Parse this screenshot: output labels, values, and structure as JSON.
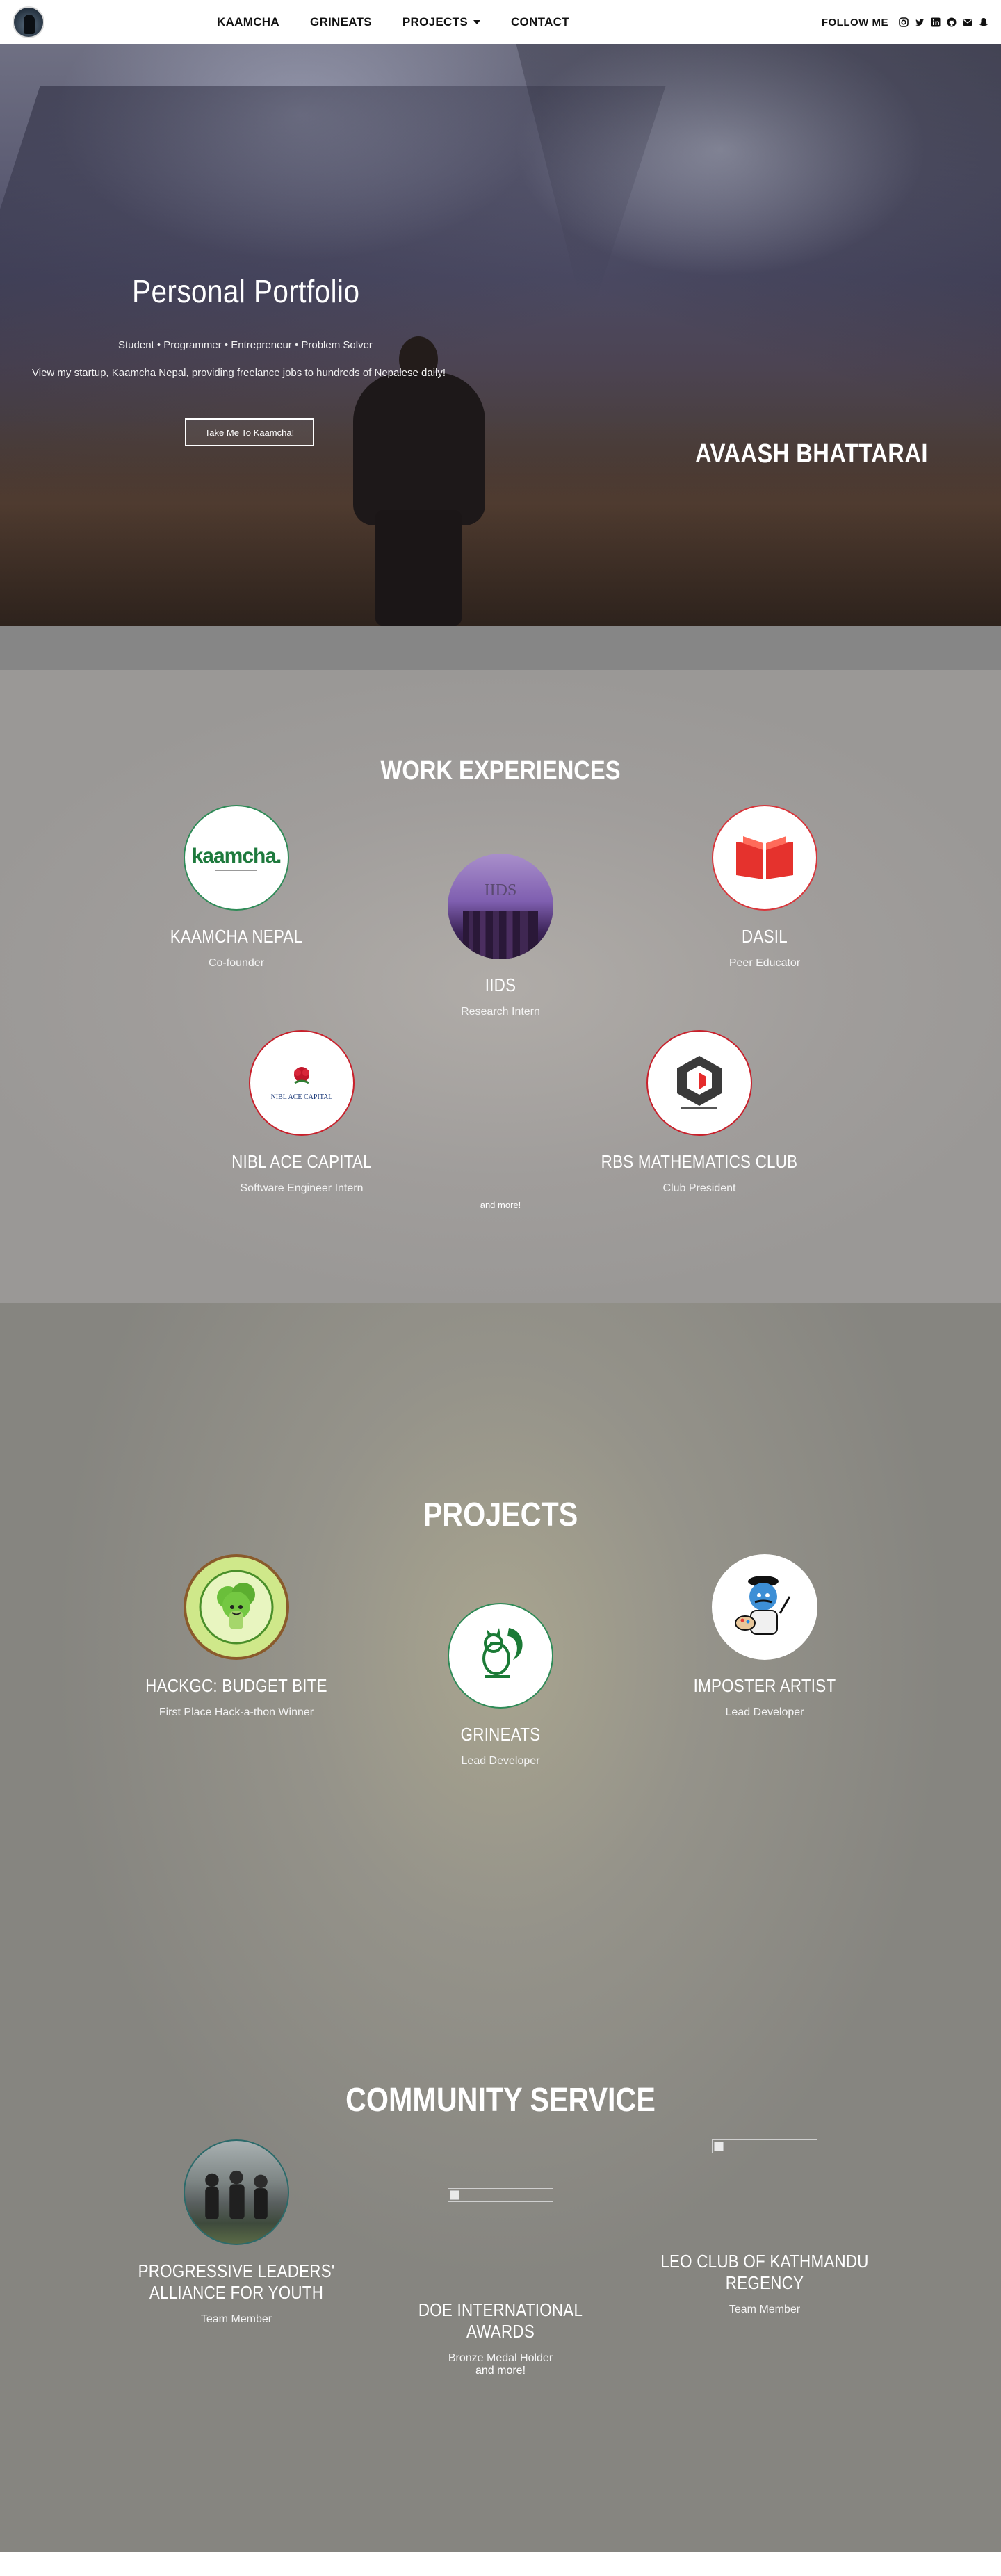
{
  "nav": {
    "menu": [
      "KAAMCHA",
      "GRINEATS",
      "PROJECTS",
      "CONTACT"
    ],
    "follow_label": "FOLLOW ME",
    "social_icons": [
      "instagram-icon",
      "twitter-icon",
      "linkedin-icon",
      "github-icon",
      "email-icon",
      "snapchat-icon"
    ]
  },
  "hero": {
    "title": "Personal Portfolio",
    "tagline": "Student • Programmer • Entrepreneur • Problem Solver",
    "description": "View my startup, Kaamcha Nepal, providing freelance jobs to hundreds of Nepalese daily!",
    "cta": "Take Me To Kaamcha!",
    "name": "AVAASH BHATTARAI"
  },
  "work": {
    "title": "WORK EXPERIENCES",
    "items": [
      {
        "name": "KAAMCHA NEPAL",
        "role": "Co-founder",
        "logo_text": "kaamcha."
      },
      {
        "name": "IIDS",
        "role": "Research Intern",
        "logo_text": "IIDS"
      },
      {
        "name": "DASIL",
        "role": "Peer Educator",
        "logo_text": ""
      },
      {
        "name": "NIBL ACE CAPITAL",
        "role": "Software Engineer Intern",
        "logo_text": "NIBL ACE CAPITAL"
      },
      {
        "name": "RBS MATHEMATICS CLUB",
        "role": "Club President",
        "logo_text": ""
      }
    ],
    "more": "and more!"
  },
  "projects": {
    "title": "PROJECTS",
    "items": [
      {
        "name": "HACKGC: BUDGET BITE",
        "role": "First Place Hack-a-thon Winner",
        "logo_text": "BUDGET BITE"
      },
      {
        "name": "GRINEATS",
        "role": "Lead Developer"
      },
      {
        "name": "IMPOSTER ARTIST",
        "role": "Lead Developer"
      }
    ]
  },
  "community": {
    "title": "COMMUNITY SERVICE",
    "items": [
      {
        "name": "PROGRESSIVE LEADERS' ALLIANCE FOR YOUTH",
        "role": "Team Member"
      },
      {
        "name": "DOE INTERNATIONAL AWARDS",
        "role": "Bronze Medal Holder"
      },
      {
        "name": "LEO CLUB OF KATHMANDU REGENCY",
        "role": "Team Member"
      }
    ],
    "more": "and more!"
  },
  "colors": {
    "accent_green": "#2e8b57",
    "accent_red": "#d9353a"
  }
}
